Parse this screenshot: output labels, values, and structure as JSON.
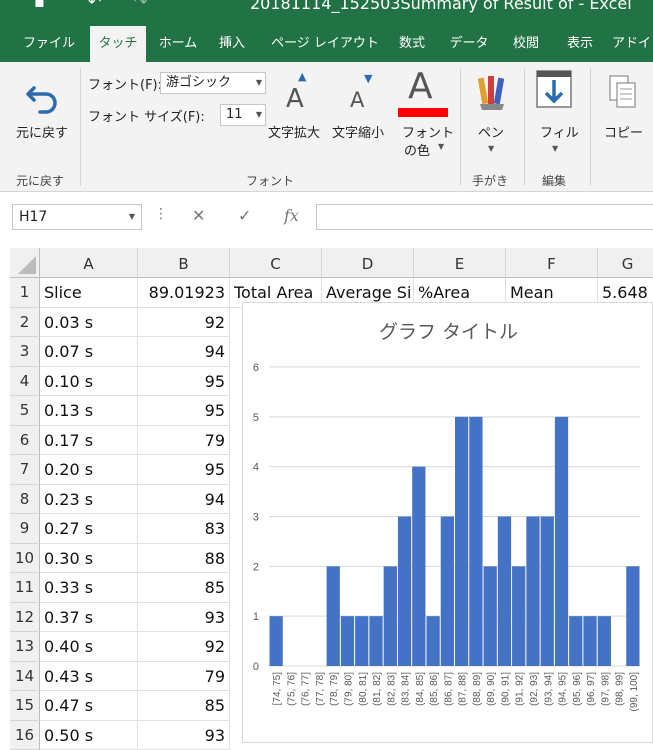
{
  "titlebar": {
    "doc_title": "20181114_152503Summary of Result of  -  Excel"
  },
  "ribbon_tabs": [
    {
      "label": "ファイル",
      "active": false
    },
    {
      "label": "タッチ",
      "active": true
    },
    {
      "label": "ホーム",
      "active": false
    },
    {
      "label": "挿入",
      "active": false
    },
    {
      "label": "ページ レイアウト",
      "active": false
    },
    {
      "label": "数式",
      "active": false
    },
    {
      "label": "データ",
      "active": false
    },
    {
      "label": "校閲",
      "active": false
    },
    {
      "label": "表示",
      "active": false
    },
    {
      "label": "アドイ",
      "active": false
    }
  ],
  "ribbon": {
    "undo_label": "元に戻す",
    "undo_group": "元に戻す",
    "font_label": "フォント(F):",
    "font_value": "游ゴシック",
    "font_size_label": "フォント サイズ(F):",
    "font_size_value": "11",
    "grow_label": "文字拡大",
    "shrink_label": "文字縮小",
    "font_color_label": "フォント",
    "font_color_label2": "の色",
    "font_group": "フォント",
    "pen_label": "ペン",
    "handwriting_group": "手がき",
    "fill_label": "フィル",
    "edit_group": "編集",
    "copy_label": "コピー",
    "font_color_value": "#ff0000"
  },
  "formula_bar": {
    "name_box": "H17",
    "formula": ""
  },
  "columns": [
    "A",
    "B",
    "C",
    "D",
    "E",
    "F",
    "G"
  ],
  "rows": [
    {
      "n": "1",
      "a": "Slice",
      "b": "89.01923",
      "c": "Total Area",
      "d": "Average Si",
      "e": "%Area",
      "f": "Mean",
      "g": "5.648"
    },
    {
      "n": "2",
      "a": "0.03 s",
      "b": "92"
    },
    {
      "n": "3",
      "a": "0.07 s",
      "b": "94"
    },
    {
      "n": "4",
      "a": "0.10 s",
      "b": "95"
    },
    {
      "n": "5",
      "a": "0.13 s",
      "b": "95"
    },
    {
      "n": "6",
      "a": "0.17 s",
      "b": "79"
    },
    {
      "n": "7",
      "a": "0.20 s",
      "b": "95"
    },
    {
      "n": "8",
      "a": "0.23 s",
      "b": "94"
    },
    {
      "n": "9",
      "a": "0.27 s",
      "b": "83"
    },
    {
      "n": "10",
      "a": "0.30 s",
      "b": "88"
    },
    {
      "n": "11",
      "a": "0.33 s",
      "b": "85"
    },
    {
      "n": "12",
      "a": "0.37 s",
      "b": "93"
    },
    {
      "n": "13",
      "a": "0.40 s",
      "b": "92"
    },
    {
      "n": "14",
      "a": "0.43 s",
      "b": "79"
    },
    {
      "n": "15",
      "a": "0.47 s",
      "b": "85"
    },
    {
      "n": "16",
      "a": "0.50 s",
      "b": "93"
    }
  ],
  "chart_data": {
    "type": "bar",
    "title": "グラフ タイトル",
    "categories": [
      "[74, 75]",
      "(75, 76]",
      "(76, 77]",
      "(77, 78]",
      "(78, 79]",
      "(79, 80]",
      "(80, 81]",
      "(81, 82]",
      "(82, 83]",
      "(83, 84]",
      "(84, 85]",
      "(85, 86]",
      "(86, 87]",
      "(87, 88]",
      "(88, 89]",
      "(89, 90]",
      "(90, 91]",
      "(91, 92]",
      "(92, 93]",
      "(93, 94]",
      "(94, 95]",
      "(95, 96]",
      "(96, 97]",
      "(97, 98]",
      "(98, 99]",
      "(99, 100]"
    ],
    "values": [
      1,
      0,
      0,
      0,
      2,
      1,
      1,
      1,
      2,
      3,
      4,
      1,
      3,
      5,
      5,
      2,
      3,
      2,
      3,
      3,
      5,
      1,
      1,
      1,
      0,
      2
    ],
    "ylim": [
      0,
      6
    ],
    "yticks": [
      0,
      1,
      2,
      3,
      4,
      5,
      6
    ],
    "grid": true,
    "bar_color": "#4472c4"
  }
}
